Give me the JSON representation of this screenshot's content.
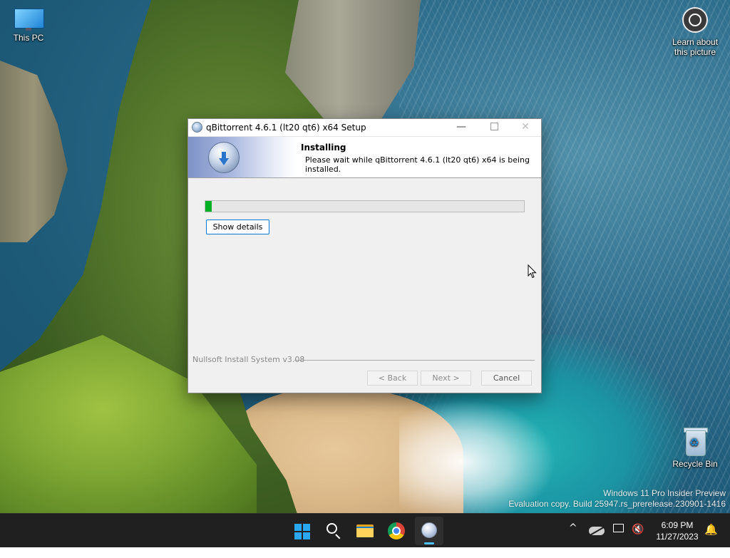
{
  "desktop": {
    "icons": {
      "this_pc": "This PC",
      "learn": "Learn about this picture",
      "recycle_bin": "Recycle Bin"
    },
    "watermark": {
      "line1": "Windows 11 Pro Insider Preview",
      "line2": "Evaluation copy. Build 25947.rs_prerelease.230901-1416"
    }
  },
  "installer": {
    "title": "qBittorrent 4.6.1 (lt20 qt6) x64 Setup",
    "header_title": "Installing",
    "header_subtitle": "Please wait while qBittorrent 4.6.1 (lt20 qt6) x64 is being installed.",
    "progress_percent": 2,
    "show_details_label": "Show details",
    "branding": "Nullsoft Install System v3.08",
    "back_label": "< Back",
    "next_label": "Next >",
    "cancel_label": "Cancel",
    "minimize_glyph": "—",
    "close_glyph": "✕"
  },
  "taskbar": {
    "icons": [
      "windows-start-icon",
      "search-icon",
      "file-explorer-icon",
      "chrome-icon",
      "qbittorrent-installer-icon"
    ],
    "tray": {
      "chevron": "^",
      "sound": "🔇",
      "bell": "🔔"
    },
    "time": "6:09 PM",
    "date": "11/27/2023"
  },
  "colors": {
    "taskbar": "#202020",
    "accent": "#0078d4",
    "progress": "#06b025"
  }
}
